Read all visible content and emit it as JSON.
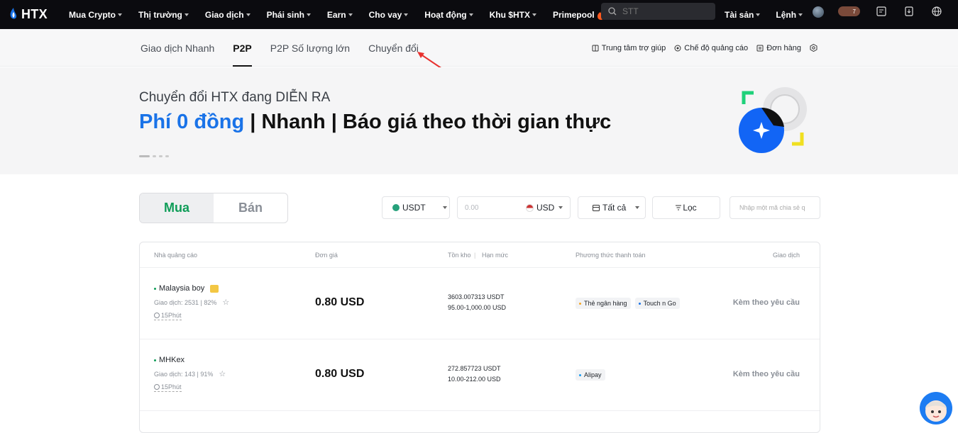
{
  "nav": {
    "logo": "HTX",
    "items": [
      "Mua Crypto",
      "Thị trường",
      "Giao dịch",
      "Phái sinh",
      "Earn",
      "Cho vay",
      "Hoạt động",
      "Khu $HTX",
      "Primepool"
    ],
    "search_placeholder": "STT",
    "assets": "Tài sản",
    "orders": "Lệnh",
    "badge_count": "7"
  },
  "subnav": {
    "tabs": [
      "Giao dịch Nhanh",
      "P2P",
      "P2P Số lượng lớn",
      "Chuyển đổi"
    ],
    "active_tab": "P2P",
    "help": "Trung tâm trợ giúp",
    "ad_mode": "Chế độ quảng cáo",
    "orders": "Đơn hàng"
  },
  "banner": {
    "subtitle": "Chuyển đổi HTX đang DIỄN RA",
    "title_highlight": "Phí 0 đồng",
    "title_rest": " | Nhanh | Báo giá theo thời gian thực"
  },
  "filters": {
    "buy": "Mua",
    "sell": "Bán",
    "coin": "USDT",
    "amount_placeholder": "0.00",
    "currency": "USD",
    "payment": "Tất cả",
    "filter": "Lọc",
    "share_code_placeholder": "Nhập một mã chia sẻ q"
  },
  "table": {
    "headers": {
      "advertiser": "Nhà quảng cáo",
      "price": "Đơn giá",
      "stock": "Tồn kho",
      "limit": "Hạn mức",
      "payment": "Phương thức thanh toán",
      "trade": "Giao dịch"
    },
    "rows": [
      {
        "name": "Malaysia boy",
        "stats": "Giao dịch: 2531 | 82%",
        "time": "15Phút",
        "price": "0.80 USD",
        "stock": "3603.007313 USDT",
        "limit": "95.00-1,000.00 USD",
        "payments": [
          "Thẻ ngân hàng",
          "Touch n Go"
        ],
        "action": "Kèm theo yêu cầu"
      },
      {
        "name": "MHKex",
        "stats": "Giao dịch: 143 | 91%",
        "time": "15Phút",
        "price": "0.80 USD",
        "stock": "272.857723 USDT",
        "limit": "10.00-212.00 USD",
        "payments": [
          "Alipay"
        ],
        "action": "Kèm theo yêu cầu"
      }
    ]
  },
  "colors": {
    "buy_green": "#0f9d58",
    "highlight_blue": "#1a73e8",
    "bank_dot": "#f5a623",
    "touch_dot": "#1a73e8",
    "alipay_dot": "#1a9cf0"
  }
}
